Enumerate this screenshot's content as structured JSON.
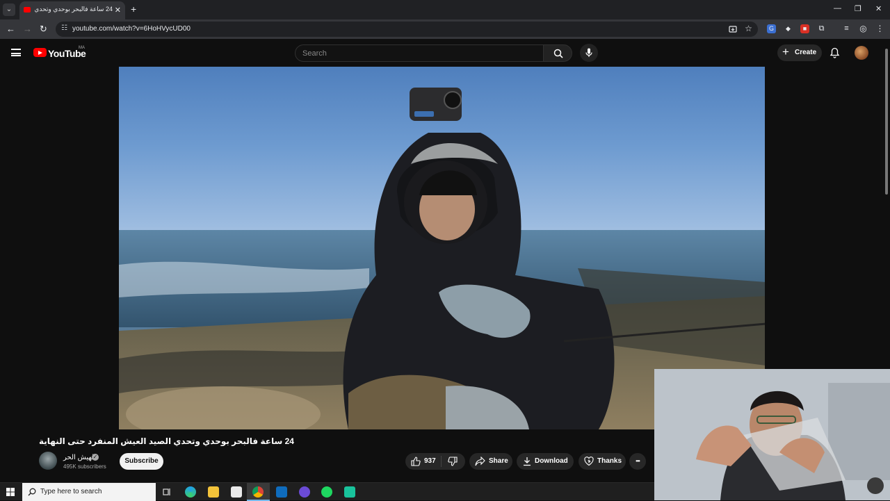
{
  "browser": {
    "tab_title": "24 ساعة فالبحر بوحدي وتحدي الصيد العيش المنفرد حتى النهاية",
    "tab_close": "✕",
    "new_tab": "+",
    "url": "youtube.com/watch?v=6HoHVycUD00",
    "window_controls": [
      "—",
      "❐",
      "✕"
    ]
  },
  "masthead": {
    "logo_text": "YouTube",
    "country_code": "MA",
    "search_placeholder": "Search",
    "create_label": "Create"
  },
  "video": {
    "title": "24 ساعة فالبحر بوحدي وتحدي الصيد العيش المنفرد حتى النهاية",
    "channel_name": "الهيش الحر",
    "subscribers": "495K subscribers",
    "subscribe_label": "Subscribe",
    "like_count": "937",
    "share_label": "Share",
    "download_label": "Download",
    "thanks_label": "Thanks",
    "more_label": "•••"
  },
  "taskbar": {
    "search_placeholder": "Type here to search"
  },
  "colors": {
    "youtube_red": "#ff0000",
    "page_bg": "#0f0f0f",
    "pill_bg": "#272727"
  }
}
